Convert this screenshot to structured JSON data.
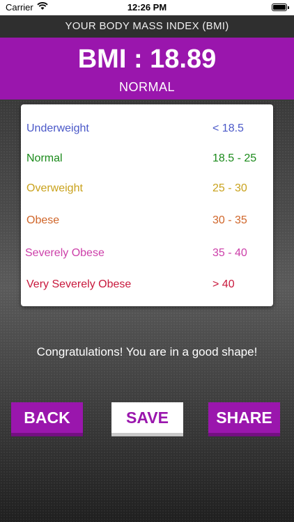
{
  "status_bar": {
    "carrier": "Carrier",
    "time": "12:26 PM"
  },
  "header": {
    "title": "YOUR BODY MASS INDEX (BMI)"
  },
  "result": {
    "bmi_text": "BMI : 18.89",
    "category": "NORMAL"
  },
  "categories": [
    {
      "label": "Underweight",
      "range": "< 18.5",
      "color": "#4a58c8"
    },
    {
      "label": "Normal",
      "range": "18.5 - 25",
      "color": "#1a8a1a"
    },
    {
      "label": "Overweight",
      "range": "25 - 30",
      "color": "#c9a21c"
    },
    {
      "label": "Obese",
      "range": "30 - 35",
      "color": "#d0662a"
    },
    {
      "label": "Severely Obese",
      "range": "35 - 40",
      "color": "#cc3fa9"
    },
    {
      "label": "Very Severely Obese",
      "range": "> 40",
      "color": "#c8183c"
    }
  ],
  "message": "Congratulations! You are in a good shape!",
  "buttons": {
    "back": "BACK",
    "save": "SAVE",
    "share": "SHARE"
  },
  "colors": {
    "accent": "#9a16ad"
  }
}
